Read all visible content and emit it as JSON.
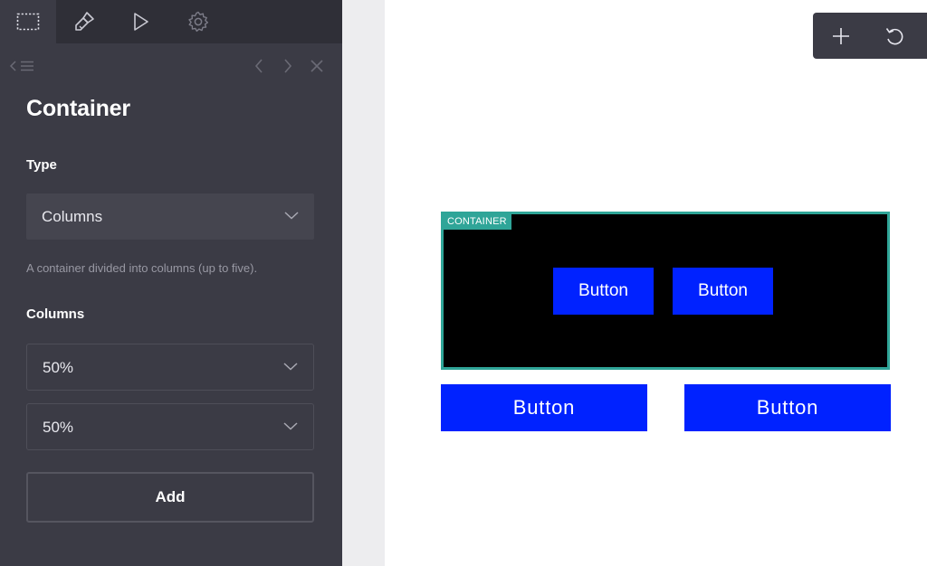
{
  "sidebar": {
    "tabs": [
      {
        "icon": "selection-icon",
        "active": true
      },
      {
        "icon": "brush-icon",
        "active": false
      },
      {
        "icon": "play-icon",
        "active": false
      },
      {
        "icon": "gear-icon",
        "active": false
      }
    ],
    "nav": {
      "back_icon": "collapse-menu-icon",
      "prev_icon": "chevron-left-icon",
      "next_icon": "chevron-right-icon",
      "close_icon": "close-icon"
    },
    "title": "Container",
    "type_section": {
      "label": "Type",
      "selected": "Columns",
      "help": "A container divided into columns (up to five)."
    },
    "columns_section": {
      "label": "Columns",
      "values": [
        "50%",
        "50%"
      ]
    },
    "add_label": "Add"
  },
  "toolbar": {
    "add_icon": "plus-icon",
    "undo_icon": "undo-icon"
  },
  "canvas": {
    "container_tag": "CONTAINER",
    "inner_buttons": [
      "Button",
      "Button"
    ],
    "outer_buttons": [
      "Button",
      "Button"
    ]
  },
  "colors": {
    "sidebar_bg": "#3b3b45",
    "topbar_bg": "#2f2f37",
    "accent_teal": "#2fa598",
    "button_blue": "#0022ff"
  }
}
